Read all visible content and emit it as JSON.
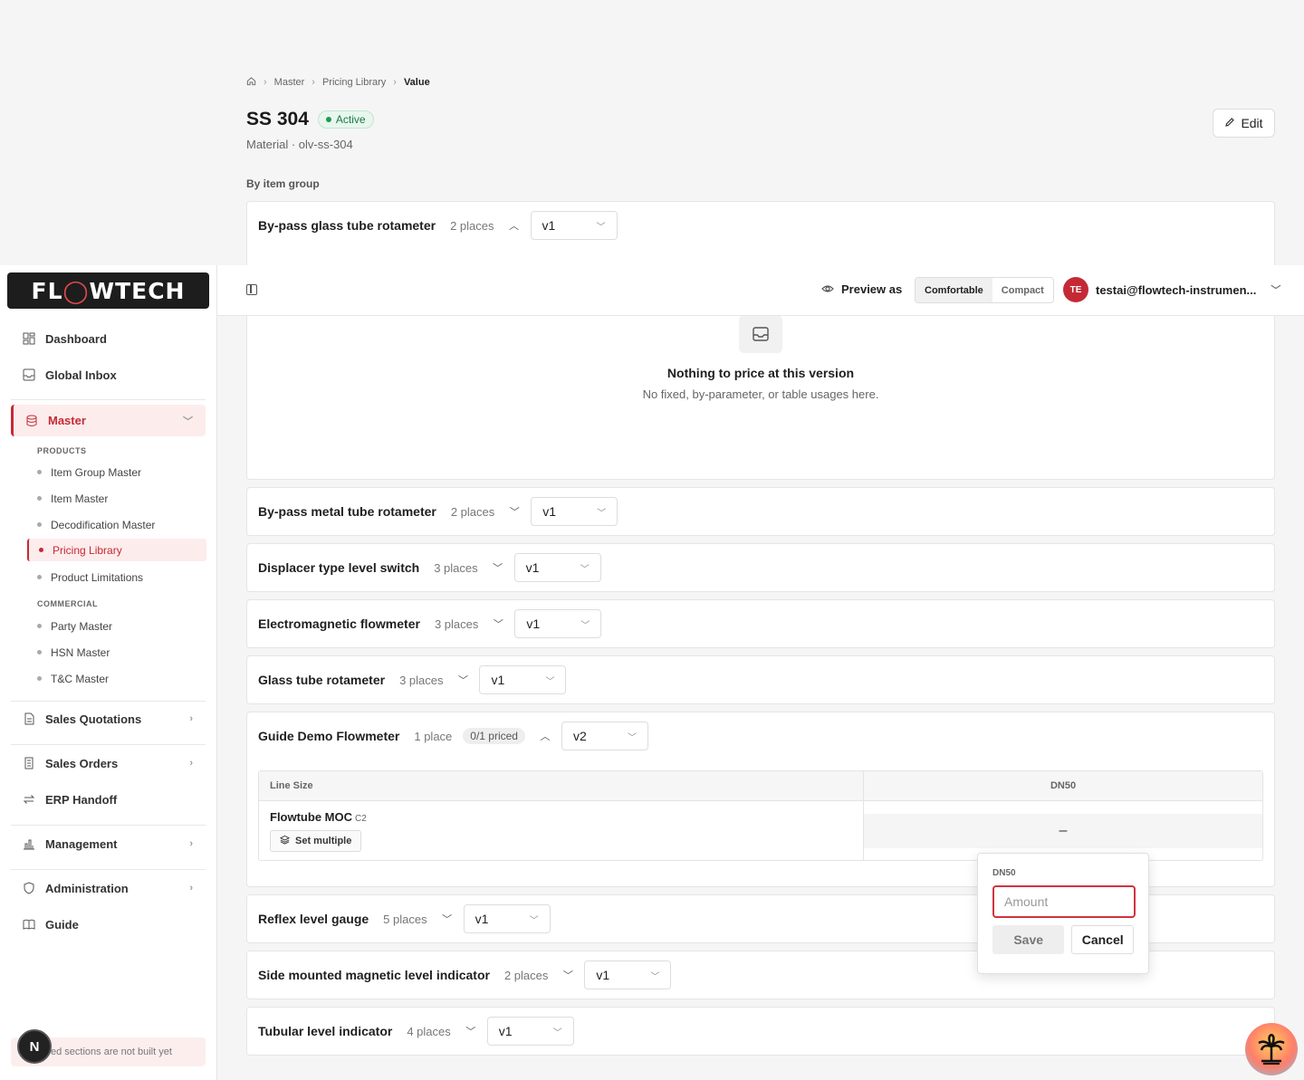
{
  "breadcrumb": {
    "home_icon": "home-icon",
    "items": [
      "Master",
      "Pricing Library"
    ],
    "current": "Value"
  },
  "page": {
    "title": "SS 304",
    "status": "Active",
    "subtitle": "Material · olv-ss-304",
    "edit_label": "Edit",
    "section_label": "By item group"
  },
  "groups": [
    {
      "name": "By-pass glass tube rotameter",
      "places": "2 places",
      "version": "v1",
      "expanded": true
    },
    {
      "name": "By-pass metal tube rotameter",
      "places": "2 places",
      "version": "v1"
    },
    {
      "name": "Displacer type level switch",
      "places": "3 places",
      "version": "v1"
    },
    {
      "name": "Electromagnetic flowmeter",
      "places": "3 places",
      "version": "v1"
    },
    {
      "name": "Glass tube rotameter",
      "places": "3 places",
      "version": "v1"
    },
    {
      "name": "Guide Demo Flowmeter",
      "places": "1 place",
      "priced": "0/1 priced",
      "version": "v2",
      "expanded": true
    },
    {
      "name": "Reflex level gauge",
      "places": "5 places",
      "version": "v1"
    },
    {
      "name": "Side mounted magnetic level indicator",
      "places": "2 places",
      "version": "v1"
    },
    {
      "name": "Tubular level indicator",
      "places": "4 places",
      "version": "v1"
    }
  ],
  "empty_state": {
    "icon": "inbox-icon",
    "title": "Nothing to price at this version",
    "subtitle": "No fixed, by-parameter, or table usages here."
  },
  "price_table": {
    "col1_header": "Line Size",
    "col2_header": "DN50",
    "row_label": "Flowtube MOC",
    "row_code": "C2",
    "set_multiple": "Set multiple",
    "cell_value": "–"
  },
  "popover": {
    "label": "DN50",
    "placeholder": "Amount",
    "save": "Save",
    "cancel": "Cancel"
  },
  "topbar": {
    "preview_label": "Preview as",
    "density_options": [
      "Comfortable",
      "Compact"
    ],
    "density_selected": "Comfortable",
    "avatar_initials": "TE",
    "user_email": "testai@flowtech-instrumen..."
  },
  "sidebar": {
    "logo_text": "FLOWTECH",
    "items": {
      "dashboard": "Dashboard",
      "global_inbox": "Global Inbox",
      "master": "Master",
      "sales_quotations": "Sales Quotations",
      "sales_orders": "Sales Orders",
      "erp_handoff": "ERP Handoff",
      "management": "Management",
      "administration": "Administration",
      "guide": "Guide"
    },
    "products_header": "PRODUCTS",
    "products": [
      "Item Group Master",
      "Item Master",
      "Decodification Master",
      "Pricing Library",
      "Product Limitations"
    ],
    "commercial_header": "COMMERCIAL",
    "commercial": [
      "Party Master",
      "HSN Master",
      "T&C Master"
    ],
    "footer_note": "ed sections are not built yet",
    "n_badge": "N"
  },
  "colors": {
    "accent": "#c42a36",
    "active_bg": "#fdecec",
    "success": "#1b7a45"
  }
}
